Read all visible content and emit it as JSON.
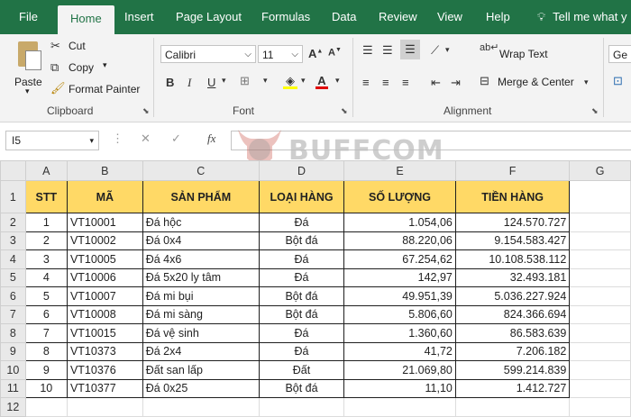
{
  "menu": {
    "tabs": [
      "File",
      "Home",
      "Insert",
      "Page Layout",
      "Formulas",
      "Data",
      "Review",
      "View",
      "Help"
    ],
    "active": "Home",
    "tell_me": "Tell me what y"
  },
  "ribbon": {
    "clipboard": {
      "paste": "Paste",
      "cut": "Cut",
      "copy": "Copy",
      "format_painter": "Format Painter",
      "label": "Clipboard"
    },
    "font": {
      "name": "Calibri",
      "size": "11",
      "label": "Font"
    },
    "alignment": {
      "wrap_text": "Wrap Text",
      "merge_center": "Merge & Center",
      "label": "Alignment"
    },
    "number": {
      "format": "Ge"
    }
  },
  "formula_bar": {
    "name_box": "I5",
    "fx": "fx",
    "value": ""
  },
  "watermark": {
    "text": "BUFFCOM"
  },
  "sheet": {
    "columns": [
      "A",
      "B",
      "C",
      "D",
      "E",
      "F",
      "G"
    ],
    "headers": [
      "STT",
      "MÃ",
      "SẢN PHẨM",
      "LOẠI HÀNG",
      "SỐ LƯỢNG",
      "TIỀN HÀNG"
    ],
    "rows": [
      [
        "1",
        "VT10001",
        "Đá hộc",
        "Đá",
        "1.054,06",
        "124.570.727"
      ],
      [
        "2",
        "VT10002",
        "Đá 0x4",
        "Bột đá",
        "88.220,06",
        "9.154.583.427"
      ],
      [
        "3",
        "VT10005",
        "Đá 4x6",
        "Đá",
        "67.254,62",
        "10.108.538.112"
      ],
      [
        "4",
        "VT10006",
        "Đá 5x20 ly tâm",
        "Đá",
        "142,97",
        "32.493.181"
      ],
      [
        "5",
        "VT10007",
        "Đá mi bụi",
        "Bột đá",
        "49.951,39",
        "5.036.227.924"
      ],
      [
        "6",
        "VT10008",
        "Đá mi sàng",
        "Bột đá",
        "5.806,60",
        "824.366.694"
      ],
      [
        "7",
        "VT10015",
        "Đá vệ sinh",
        "Đá",
        "1.360,60",
        "86.583.639"
      ],
      [
        "8",
        "VT10373",
        "Đá 2x4",
        "Đá",
        "41,72",
        "7.206.182"
      ],
      [
        "9",
        "VT10376",
        "Đất san lấp",
        "Đất",
        "21.069,80",
        "599.214.839"
      ],
      [
        "10",
        "VT10377",
        "Đá 0x25",
        "Bột đá",
        "11,10",
        "1.412.727"
      ]
    ],
    "row_numbers": [
      "1",
      "2",
      "3",
      "4",
      "5",
      "6",
      "7",
      "8",
      "9",
      "10",
      "11",
      "12"
    ],
    "header_fill": "#ffd966"
  }
}
